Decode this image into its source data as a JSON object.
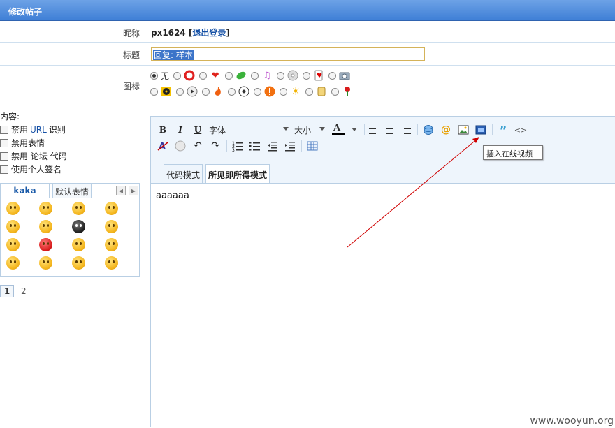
{
  "header": {
    "title": "修改帖子"
  },
  "form": {
    "nickname_label": "昵称",
    "nickname_value": "px1624",
    "logout_link": "退出登录",
    "subject_label": "标题",
    "subject_value": "回复: 样本",
    "icon_label": "图标",
    "icon_none_label": "无"
  },
  "options": {
    "content_label": "内容:",
    "disable_url_prefix": "禁用",
    "disable_url_link": "URL",
    "disable_url_suffix": "识别",
    "disable_smilies": "禁用表情",
    "disable_code": "禁用 论坛 代码",
    "use_signature": "使用个人签名"
  },
  "smilies": {
    "tabs": [
      "kaka",
      "默认表情"
    ],
    "pages": [
      "1",
      "2"
    ]
  },
  "toolbar": {
    "bold": "B",
    "italic": "I",
    "underline": "U",
    "font_select": "字体",
    "size_select": "大小",
    "font_color": "A",
    "tooltip": "插入在线视频"
  },
  "editor": {
    "mode_tabs": [
      "代码模式",
      "所见即所得模式"
    ],
    "content": "aaaaaa"
  },
  "watermark": "www.wooyun.org",
  "colors": {
    "header": "#3f7fd6",
    "link": "#1550a5",
    "annotation_arrow": "#d00000"
  }
}
